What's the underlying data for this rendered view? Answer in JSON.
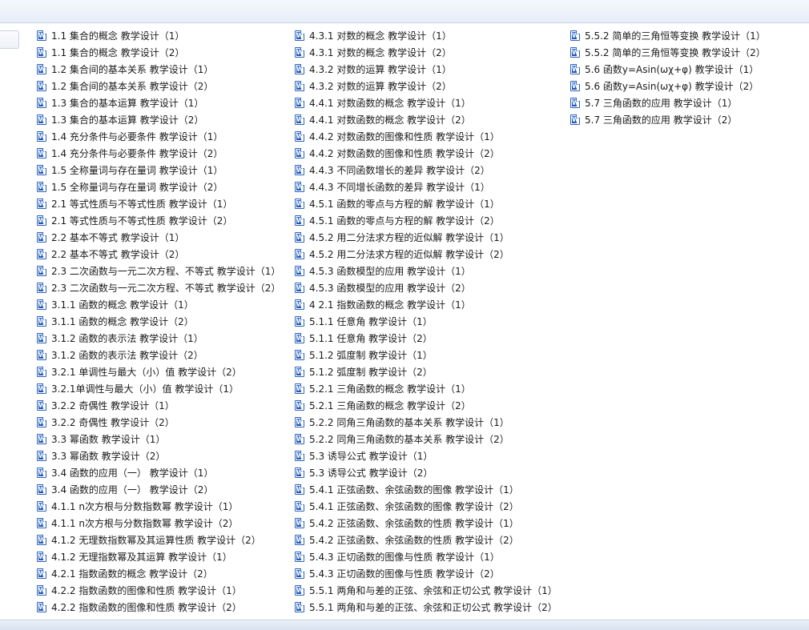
{
  "files": {
    "column1": [
      "1.1 集合的概念 教学设计（1）",
      "1.1 集合的概念 教学设计（2）",
      "1.2 集合间的基本关系 教学设计（1）",
      "1.2 集合间的基本关系 教学设计（2）",
      "1.3 集合的基本运算 教学设计（1）",
      "1.3 集合的基本运算 教学设计（2）",
      "1.4 充分条件与必要条件 教学设计（1）",
      "1.4 充分条件与必要条件 教学设计（2）",
      "1.5 全称量词与存在量词 教学设计（1）",
      "1.5 全称量词与存在量词 教学设计（2）",
      "2.1 等式性质与不等式性质 教学设计（1）",
      "2.1 等式性质与不等式性质 教学设计（2）",
      "2.2 基本不等式 教学设计（1）",
      "2.2 基本不等式 教学设计（2）",
      "2.3 二次函数与一元二次方程、不等式 教学设计（1）",
      "2.3 二次函数与一元二次方程、不等式 教学设计（2）",
      "3.1.1 函数的概念 教学设计（1）",
      "3.1.1 函数的概念 教学设计（2）",
      "3.1.2 函数的表示法 教学设计（1）",
      "3.1.2 函数的表示法 教学设计（2）",
      "3.2.1 单调性与最大（小）值 教学设计（2）",
      "3.2.1单调性与最大（小）值 教学设计（1）",
      "3.2.2 奇偶性 教学设计（1）",
      "3.2.2 奇偶性 教学设计（2）",
      "3.3 幂函数 教学设计（1）",
      "3.3 幂函数 教学设计（2）",
      "3.4 函数的应用（一） 教学设计（1）",
      "3.4 函数的应用（一） 教学设计（2）",
      "4.1.1 n次方根与分数指数幂 教学设计（1）",
      "4.1.1 n次方根与分数指数幂 教学设计（2）",
      "4.1.2 无理数指数幂及其运算性质 教学设计（2）",
      "4.1.2 无理指数幂及其运算 教学设计（1）",
      "4.2.1 指数函数的概念 教学设计（2）",
      "4.2.2 指数函数的图像和性质 教学设计（1）",
      "4.2.2 指数函数的图像和性质 教学设计（2）"
    ],
    "column2": [
      "4.3.1 对数的概念 教学设计（1）",
      "4.3.1 对数的概念 教学设计（2）",
      "4.3.2 对数的运算 教学设计（1）",
      "4.3.2 对数的运算 教学设计（2）",
      "4.4.1 对数函数的概念 教学设计（1）",
      "4.4.1 对数函数的概念 教学设计（2）",
      "4.4.2 对数函数的图像和性质 教学设计（1）",
      "4.4.2 对数函数的图像和性质 教学设计（2）",
      "4.4.3 不同函数增长的差异 教学设计（2）",
      "4.4.3 不同增长函数的差异 教学设计（1）",
      "4.5.1 函数的零点与方程的解 教学设计（1）",
      "4.5.1 函数的零点与方程的解 教学设计（2）",
      "4.5.2 用二分法求方程的近似解 教学设计（1）",
      "4.5.2 用二分法求方程的近似解 教学设计（2）",
      "4.5.3 函数模型的应用 教学设计（1）",
      "4.5.3 函数模型的应用 教学设计（2）",
      "4 2.1 指数函数的概念 教学设计（1）",
      "5.1.1 任意角 教学设计（1）",
      "5.1.1 任意角 教学设计（2）",
      "5.1.2 弧度制 教学设计（1）",
      "5.1.2 弧度制 教学设计（2）",
      "5.2.1 三角函数的概念 教学设计（1）",
      "5.2.1 三角函数的概念 教学设计（2）",
      "5.2.2 同角三角函数的基本关系 教学设计（1）",
      "5.2.2 同角三角函数的基本关系 教学设计（2）",
      "5.3 诱导公式 教学设计（1）",
      "5.3 诱导公式 教学设计（2）",
      "5.4.1 正弦函数、余弦函数的图像 教学设计（1）",
      "5.4.1 正弦函数、余弦函数的图像 教学设计（2）",
      "5.4.2 正弦函数、余弦函数的性质 教学设计（1）",
      "5.4.2 正弦函数、余弦函数的性质 教学设计（2）",
      "5.4.3 正切函数的图像与性质 教学设计（1）",
      "5.4.3 正切函数的图像与性质 教学设计（2）",
      "5.5.1 两角和与差的正弦、余弦和正切公式 教学设计（1）",
      "5.5.1 两角和与差的正弦、余弦和正切公式 教学设计（2）"
    ],
    "column3": [
      "5.5.2 简单的三角恒等变换 教学设计（1）",
      "5.5.2 简单的三角恒等变换 教学设计（2）",
      "5.6 函数y=Asin(ωχ+φ) 教学设计（1）",
      "5.6 函数y=Asin(ωχ+φ) 教学设计（2）",
      "5.7 三角函数的应用 教学设计（1）",
      "5.7 三角函数的应用 教学设计（2）"
    ]
  },
  "icon": "word-document-icon"
}
